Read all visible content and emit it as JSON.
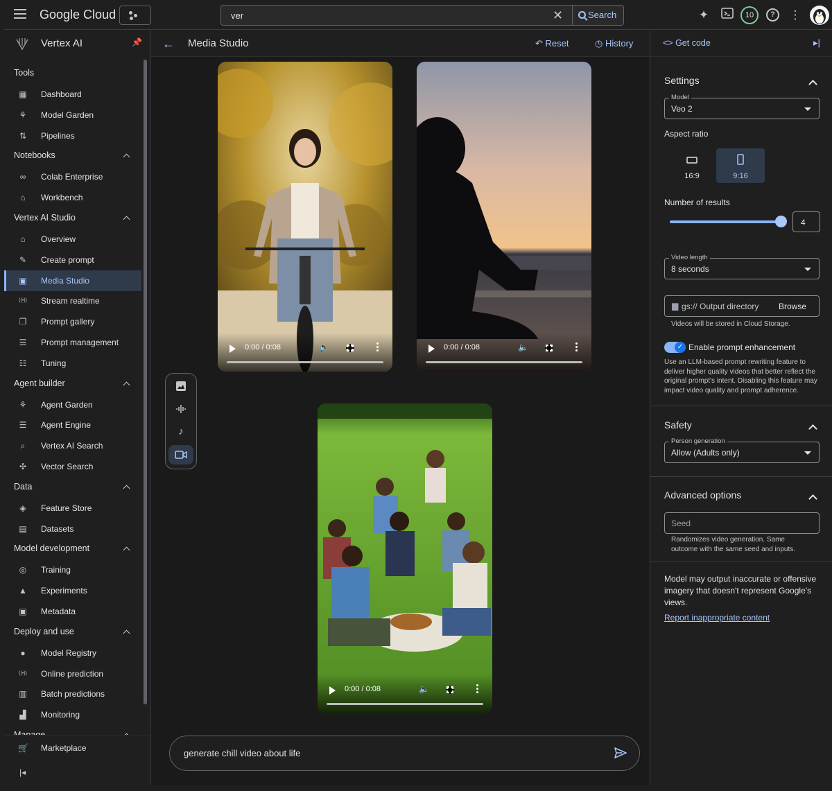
{
  "app": {
    "logo": "Google Cloud"
  },
  "search": {
    "value": "ver",
    "button": "Search"
  },
  "topbar": {
    "badge": "10"
  },
  "sidebar": {
    "product": "Vertex AI",
    "sections": [
      {
        "title": "Tools",
        "items": [
          "Dashboard",
          "Model Garden",
          "Pipelines"
        ]
      },
      {
        "title": "Notebooks",
        "items": [
          "Colab Enterprise",
          "Workbench"
        ]
      },
      {
        "title": "Vertex AI Studio",
        "items": [
          "Overview",
          "Create prompt",
          "Media Studio",
          "Stream realtime",
          "Prompt gallery",
          "Prompt management",
          "Tuning"
        ]
      },
      {
        "title": "Agent builder",
        "items": [
          "Agent Garden",
          "Agent Engine",
          "Vertex AI Search",
          "Vector Search"
        ]
      },
      {
        "title": "Data",
        "items": [
          "Feature Store",
          "Datasets"
        ]
      },
      {
        "title": "Model development",
        "items": [
          "Training",
          "Experiments",
          "Metadata"
        ]
      },
      {
        "title": "Deploy and use",
        "items": [
          "Model Registry",
          "Online prediction",
          "Batch predictions",
          "Monitoring"
        ]
      },
      {
        "title": "Manage",
        "items": []
      }
    ],
    "bottom_item": "Marketplace",
    "active_item": "Media Studio"
  },
  "main": {
    "title": "Media Studio",
    "reset": "Reset",
    "history": "History",
    "videos": [
      {
        "time": "0:00 / 0:08",
        "scene": "woman-cycling"
      },
      {
        "time": "0:00 / 0:08",
        "scene": "meditation-sunset"
      },
      {
        "time": "0:00 / 0:08",
        "scene": "picnic-friends"
      }
    ],
    "tools": [
      "image-icon",
      "audio-wave-icon",
      "music-note-icon",
      "video-camera-icon"
    ],
    "selected_tool": "video-camera-icon",
    "prompt": "generate chill video about life"
  },
  "panel": {
    "get_code": "Get code",
    "settings": {
      "title": "Settings",
      "model_label": "Model",
      "model_value": "Veo 2",
      "aspect_label": "Aspect ratio",
      "ratios": [
        "16:9",
        "9:16"
      ],
      "selected_ratio": "9:16",
      "results_label": "Number of results",
      "results_value": "4",
      "length_label": "Video length",
      "length_value": "8 seconds",
      "output_placeholder": "gs:// Output directory",
      "browse": "Browse",
      "storage_note": "Videos will be stored in Cloud Storage.",
      "enhance_label": "Enable prompt enhancement",
      "enhance_on": true,
      "enhance_desc": "Use an LLM-based prompt rewriting feature to deliver higher quality videos that better reflect the original prompt's intent. Disabling this feature may impact video quality and prompt adherence."
    },
    "safety": {
      "title": "Safety",
      "person_label": "Person generation",
      "person_value": "Allow (Adults only)"
    },
    "advanced": {
      "title": "Advanced options",
      "seed_placeholder": "Seed",
      "seed_note": "Randomizes video generation. Same outcome with the same seed and inputs."
    },
    "disclaimer": "Model may output inaccurate or offensive imagery that doesn't represent Google's views.",
    "report": "Report inappropriate content"
  },
  "colors": {
    "accent": "#a8c7fa",
    "background": "#1f1f1f",
    "active_bg": "#2f3a4a"
  }
}
